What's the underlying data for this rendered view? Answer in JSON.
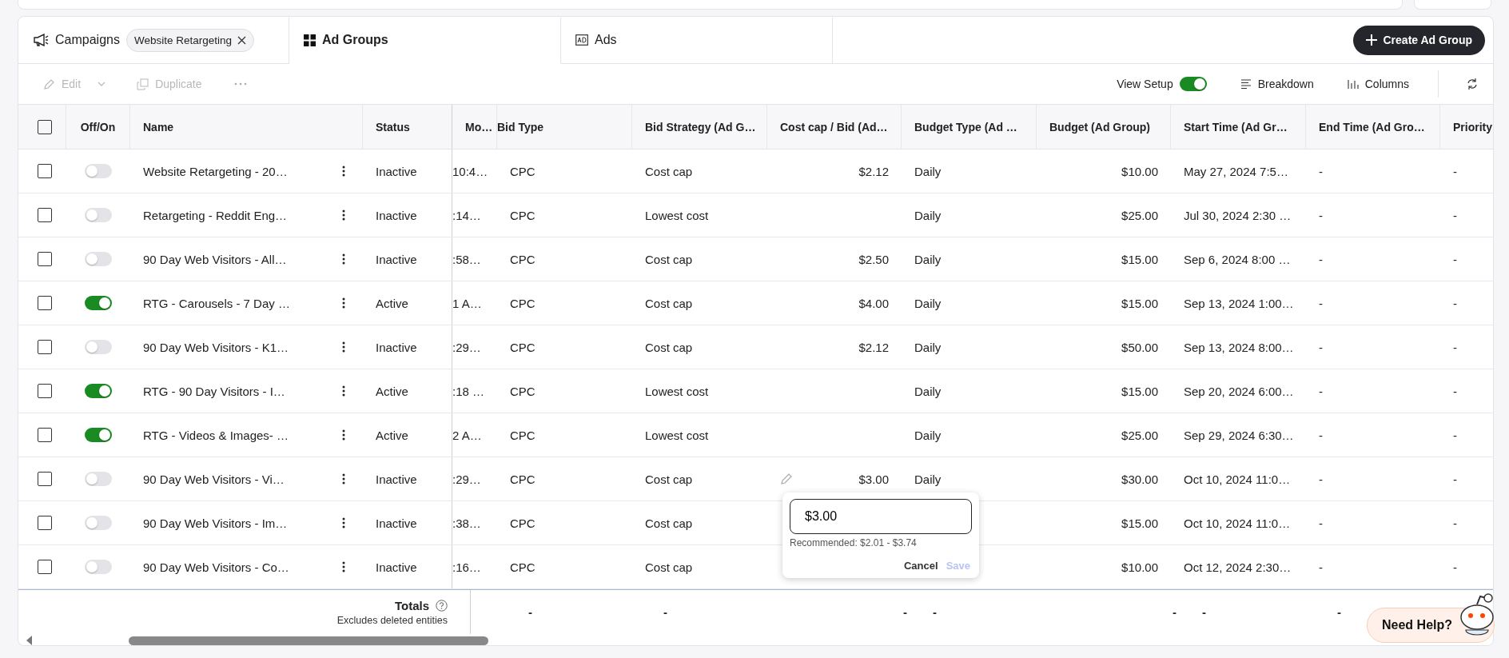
{
  "tabs": [
    {
      "label": "Campaigns",
      "selected": false,
      "filter_chip": "Website Retargeting"
    },
    {
      "label": "Ad Groups",
      "selected": true
    },
    {
      "label": "Ads",
      "selected": false
    }
  ],
  "create_button": "Create Ad Group",
  "toolbar": {
    "edit": {
      "label": "Edit",
      "disabled": true
    },
    "duplicate": {
      "label": "Duplicate",
      "disabled": true
    },
    "view_setup": {
      "label": "View Setup",
      "on": true
    },
    "breakdown": "Breakdown",
    "columns": "Columns"
  },
  "table": {
    "select_all": false,
    "columns": [
      "Off/On",
      "Name",
      "Status",
      "Mo…",
      "Bid Type",
      "Bid Strategy (Ad G…",
      "Cost cap / Bid (Ad…",
      "Budget Type (Ad …",
      "Budget (Ad Group)",
      "Start Time (Ad Gr…",
      "End Time (Ad Gro…",
      "Priority"
    ],
    "rows": [
      {
        "checked": false,
        "on": false,
        "cells": [
          "",
          "Website Retargeting - 20…",
          "Inactive",
          "10:4…",
          "CPC",
          "Cost cap",
          "$2.12",
          "Daily",
          "$10.00",
          "May 27, 2024 7:5…",
          "-",
          "-"
        ],
        "hovered": false
      },
      {
        "checked": false,
        "on": false,
        "cells": [
          "",
          "Retargeting - Reddit Eng…",
          "Inactive",
          ":14…",
          "CPC",
          "Lowest cost",
          "",
          "Daily",
          "$25.00",
          "Jul 30, 2024 2:30 …",
          "-",
          "-"
        ],
        "hovered": false
      },
      {
        "checked": false,
        "on": false,
        "cells": [
          "",
          "90 Day Web Visitors - All…",
          "Inactive",
          ":58…",
          "CPC",
          "Cost cap",
          "$2.50",
          "Daily",
          "$15.00",
          "Sep 6, 2024 8:00 …",
          "-",
          "-"
        ],
        "hovered": false
      },
      {
        "checked": false,
        "on": true,
        "cells": [
          "",
          "RTG - Carousels - 7 Day …",
          "Active",
          "1 A…",
          "CPC",
          "Cost cap",
          "$4.00",
          "Daily",
          "$15.00",
          "Sep 13, 2024 1:00…",
          "-",
          "-"
        ],
        "hovered": false
      },
      {
        "checked": false,
        "on": false,
        "cells": [
          "",
          "90 Day Web Visitors - K1…",
          "Inactive",
          ":29…",
          "CPC",
          "Cost cap",
          "$2.12",
          "Daily",
          "$50.00",
          "Sep 13, 2024 8:00…",
          "-",
          "-"
        ],
        "hovered": false
      },
      {
        "checked": false,
        "on": true,
        "cells": [
          "",
          "RTG - 90 Day Visitors - I…",
          "Active",
          ":18 …",
          "CPC",
          "Lowest cost",
          "",
          "Daily",
          "$15.00",
          "Sep 20, 2024 6:00…",
          "-",
          "-"
        ],
        "hovered": false
      },
      {
        "checked": false,
        "on": true,
        "cells": [
          "",
          "RTG - Videos & Images- …",
          "Active",
          "2 A…",
          "CPC",
          "Lowest cost",
          "",
          "Daily",
          "$25.00",
          "Sep 29, 2024 6:30…",
          "-",
          "-"
        ],
        "hovered": false
      },
      {
        "checked": false,
        "on": false,
        "cells": [
          "",
          "90 Day Web Visitors - Vi…",
          "Inactive",
          ":29…",
          "CPC",
          "Cost cap",
          "$3.00",
          "Daily",
          "$30.00",
          "Oct 10, 2024 11:0…",
          "-",
          "-"
        ],
        "hovered": true
      },
      {
        "checked": false,
        "on": false,
        "cells": [
          "",
          "90 Day Web Visitors - Im…",
          "Inactive",
          ":38…",
          "CPC",
          "Cost cap",
          "",
          "",
          "$15.00",
          "Oct 10, 2024 11:0…",
          "-",
          "-"
        ],
        "hovered": false
      },
      {
        "checked": false,
        "on": false,
        "cells": [
          "",
          "90 Day Web Visitors - Co…",
          "Inactive",
          ":16…",
          "CPC",
          "Cost cap",
          "",
          "",
          "$10.00",
          "Oct 12, 2024 2:30…",
          "-",
          "-"
        ],
        "hovered": false
      }
    ],
    "totals": {
      "label": "Totals",
      "note": "Excludes deleted entities",
      "cells": [
        "",
        "-",
        "-",
        "-",
        "-",
        "-",
        "-",
        "-"
      ]
    }
  },
  "popover": {
    "value": "$3.00",
    "hint": "Recommended: $2.01 - $3.74",
    "cancel": "Cancel",
    "save": {
      "label": "Save",
      "disabled": true
    }
  },
  "help_button": "Need Help?"
}
